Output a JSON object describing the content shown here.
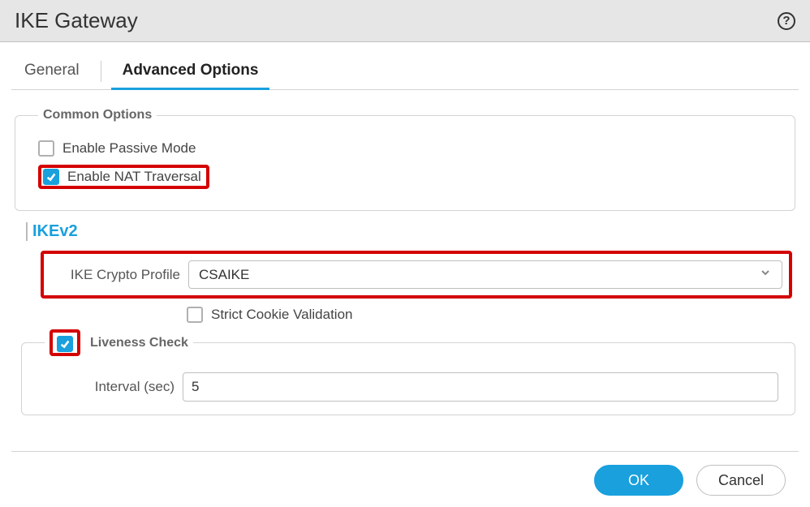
{
  "header": {
    "title": "IKE Gateway"
  },
  "tabs": {
    "general": "General",
    "advanced": "Advanced Options"
  },
  "common": {
    "legend": "Common Options",
    "passive": {
      "label": "Enable Passive Mode",
      "checked": false
    },
    "nat": {
      "label": "Enable NAT Traversal",
      "checked": true
    }
  },
  "ikev2": {
    "title": "IKEv2",
    "profile_label": "IKE Crypto Profile",
    "profile_value": "CSAIKE",
    "strict": {
      "label": "Strict Cookie Validation",
      "checked": false
    }
  },
  "liveness": {
    "legend": "Liveness Check",
    "checked": true,
    "interval_label": "Interval (sec)",
    "interval_value": "5"
  },
  "footer": {
    "ok": "OK",
    "cancel": "Cancel"
  }
}
